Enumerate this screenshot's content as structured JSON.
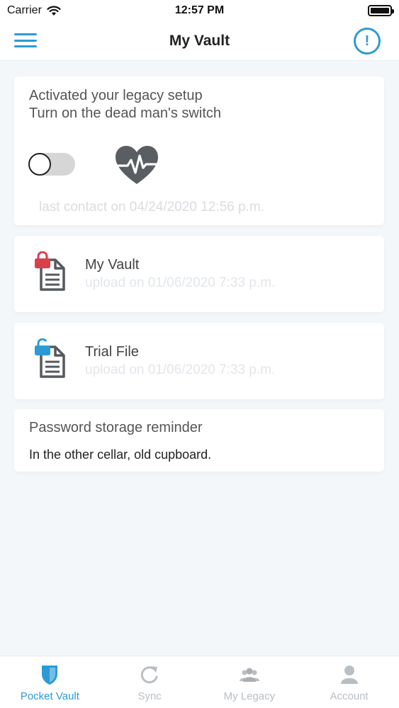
{
  "status_bar": {
    "carrier": "Carrier",
    "time": "12:57 PM"
  },
  "nav": {
    "title": "My Vault",
    "menu_icon": "hamburger-menu-icon",
    "alert_icon": "exclamation-circle-icon",
    "alert_symbol": "!"
  },
  "legacy_card": {
    "line1": "Activated your legacy setup",
    "line2": "Turn on the dead man's switch",
    "switch_on": false,
    "icon": "heartbeat-icon",
    "last_contact": "last contact on 04/24/2020 12:56 p.m."
  },
  "files": [
    {
      "name": "My Vault",
      "upload": "upload on 01/06/2020 7:33 p.m.",
      "lock_color": "#d9404a",
      "icon": "locked-document-icon"
    },
    {
      "name": "Trial File",
      "upload": "upload on 01/06/2020 7:33 p.m.",
      "lock_color": "#2d9ad6",
      "icon": "unlocked-document-icon"
    }
  ],
  "reminder": {
    "title": "Password storage reminder",
    "text": "In the other cellar, old cupboard."
  },
  "tabs": [
    {
      "label": "Pocket Vault",
      "icon": "shield-icon",
      "active": true
    },
    {
      "label": "Sync",
      "icon": "refresh-icon",
      "active": false
    },
    {
      "label": "My Legacy",
      "icon": "group-icon",
      "active": false
    },
    {
      "label": "Account",
      "icon": "user-icon",
      "active": false
    }
  ],
  "colors": {
    "accent": "#2d9ad6",
    "lock_red": "#d9404a",
    "icon_gray": "#555a5f",
    "inactive_tab": "#b9bec3"
  }
}
